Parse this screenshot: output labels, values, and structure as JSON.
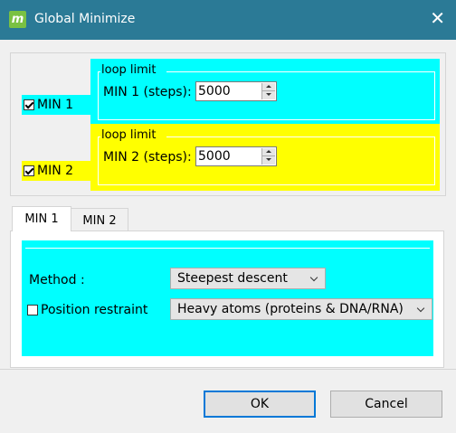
{
  "window": {
    "title": "Global Minimize",
    "app_icon_letter": "m",
    "close_glyph": "✕"
  },
  "min1": {
    "checkbox_label": "MIN 1",
    "checked": true,
    "group_title": "loop limit",
    "steps_label": "MIN 1 (steps):",
    "steps_value": "5000",
    "color": "#00ffff"
  },
  "min2": {
    "checkbox_label": "MIN 2",
    "checked": true,
    "group_title": "loop limit",
    "steps_label": "MIN 2 (steps):",
    "steps_value": "5000",
    "color": "#ffff00"
  },
  "tabs": [
    {
      "label": "MIN 1",
      "active": true
    },
    {
      "label": "MIN 2",
      "active": false
    }
  ],
  "tab_content": {
    "method_label": "Method :",
    "method_value": "Steepest descent",
    "restraint_label": "Position restraint",
    "restraint_checked": false,
    "restraint_value": "Heavy atoms (proteins & DNA/RNA)"
  },
  "buttons": {
    "ok": "OK",
    "cancel": "Cancel"
  }
}
